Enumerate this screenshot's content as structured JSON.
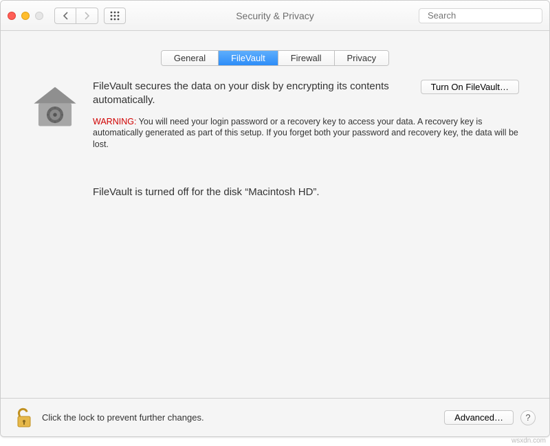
{
  "header": {
    "title": "Security & Privacy",
    "search_placeholder": "Search"
  },
  "tabs": [
    {
      "label": "General",
      "selected": false
    },
    {
      "label": "FileVault",
      "selected": true
    },
    {
      "label": "Firewall",
      "selected": false
    },
    {
      "label": "Privacy",
      "selected": false
    }
  ],
  "main": {
    "heading": "FileVault secures the data on your disk by encrypting its contents automatically.",
    "turn_on_label": "Turn On FileVault…",
    "warning_label": "WARNING:",
    "warning_text": "You will need your login password or a recovery key to access your data. A recovery key is automatically generated as part of this setup. If you forget both your password and recovery key, the data will be lost.",
    "status_text": "FileVault is turned off for the disk “Macintosh HD”."
  },
  "bottom": {
    "lock_text": "Click the lock to prevent further changes.",
    "advanced_label": "Advanced…"
  },
  "watermark": "wsxdn.com"
}
